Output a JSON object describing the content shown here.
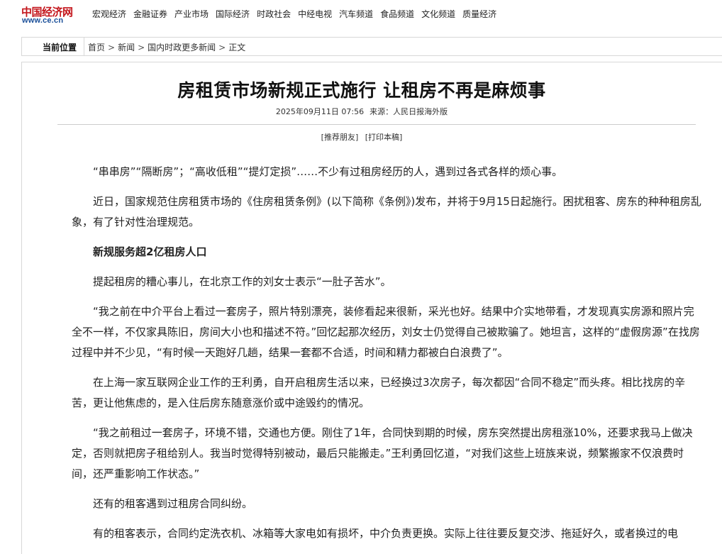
{
  "logo": {
    "main": "中国经济网",
    "url": "www.ce.cn"
  },
  "nav": [
    "宏观经济",
    "金融证券",
    "产业市场",
    "国际经济",
    "时政社会",
    "中经电视",
    "汽车频道",
    "食品频道",
    "文化频道",
    "质量经济"
  ],
  "breadcrumb": {
    "label": "当前位置",
    "items": [
      "首页",
      "新闻",
      "国内时政更多新闻",
      "正文"
    ],
    "separator": ">"
  },
  "article": {
    "title": "房租赁市场新规正式施行 让租房不再是麻烦事",
    "date": "2025年09月11日 07:56",
    "source": "来源：人民日报海外版",
    "tools": [
      "[推荐朋友]",
      "[打印本稿]"
    ],
    "paragraphs": [
      "“串串房”“隔断房”；“高收低租”“提灯定损”……不少有过租房经历的人，遇到过各式各样的烦心事。",
      "近日，国家规范住房租赁市场的《住房租赁条例》(以下简称《条例》)发布，并将于9月15日起施行。困扰租客、房东的种种租房乱象，有了针对性治理规范。",
      "新规服务超2亿租房人口",
      "提起租房的糟心事儿，在北京工作的刘女士表示“一肚子苦水”。",
      "“我之前在中介平台上看过一套房子，照片特别漂亮，装修看起来很新，采光也好。结果中介实地带看，才发现真实房源和照片完全不一样，不仅家具陈旧，房间大小也和描述不符。”回忆起那次经历，刘女士仍觉得自己被欺骗了。她坦言，这样的“虚假房源”在找房过程中并不少见，“有时候一天跑好几趟，结果一套都不合适，时间和精力都被白白浪费了”。",
      "在上海一家互联网企业工作的王利勇，自开启租房生活以来，已经换过3次房子，每次都因“合同不稳定”而头疼。相比找房的辛苦，更让他焦虑的，是入住后房东随意涨价或中途毁约的情况。",
      "“我之前租过一套房子，环境不错，交通也方便。刚住了1年，合同快到期的时候，房东突然提出房租涨10%，还要求我马上做决定，否则就把房子租给别人。我当时觉得特别被动，最后只能搬走。”王利勇回忆道，“对我们这些上班族来说，频繁搬家不仅浪费时间，还严重影响工作状态。”",
      "还有的租客遇到过租房合同纠纷。",
      "有的租客表示，合同约定洗衣机、冰箱等大家电如有损坏，中介负责更换。实际上往往要反复交涉、拖延好久，或者换过的电"
    ]
  },
  "colors": {
    "logo_red": "#c4161c",
    "logo_blue": "#1a4f99",
    "border": "#d8d8d8"
  }
}
